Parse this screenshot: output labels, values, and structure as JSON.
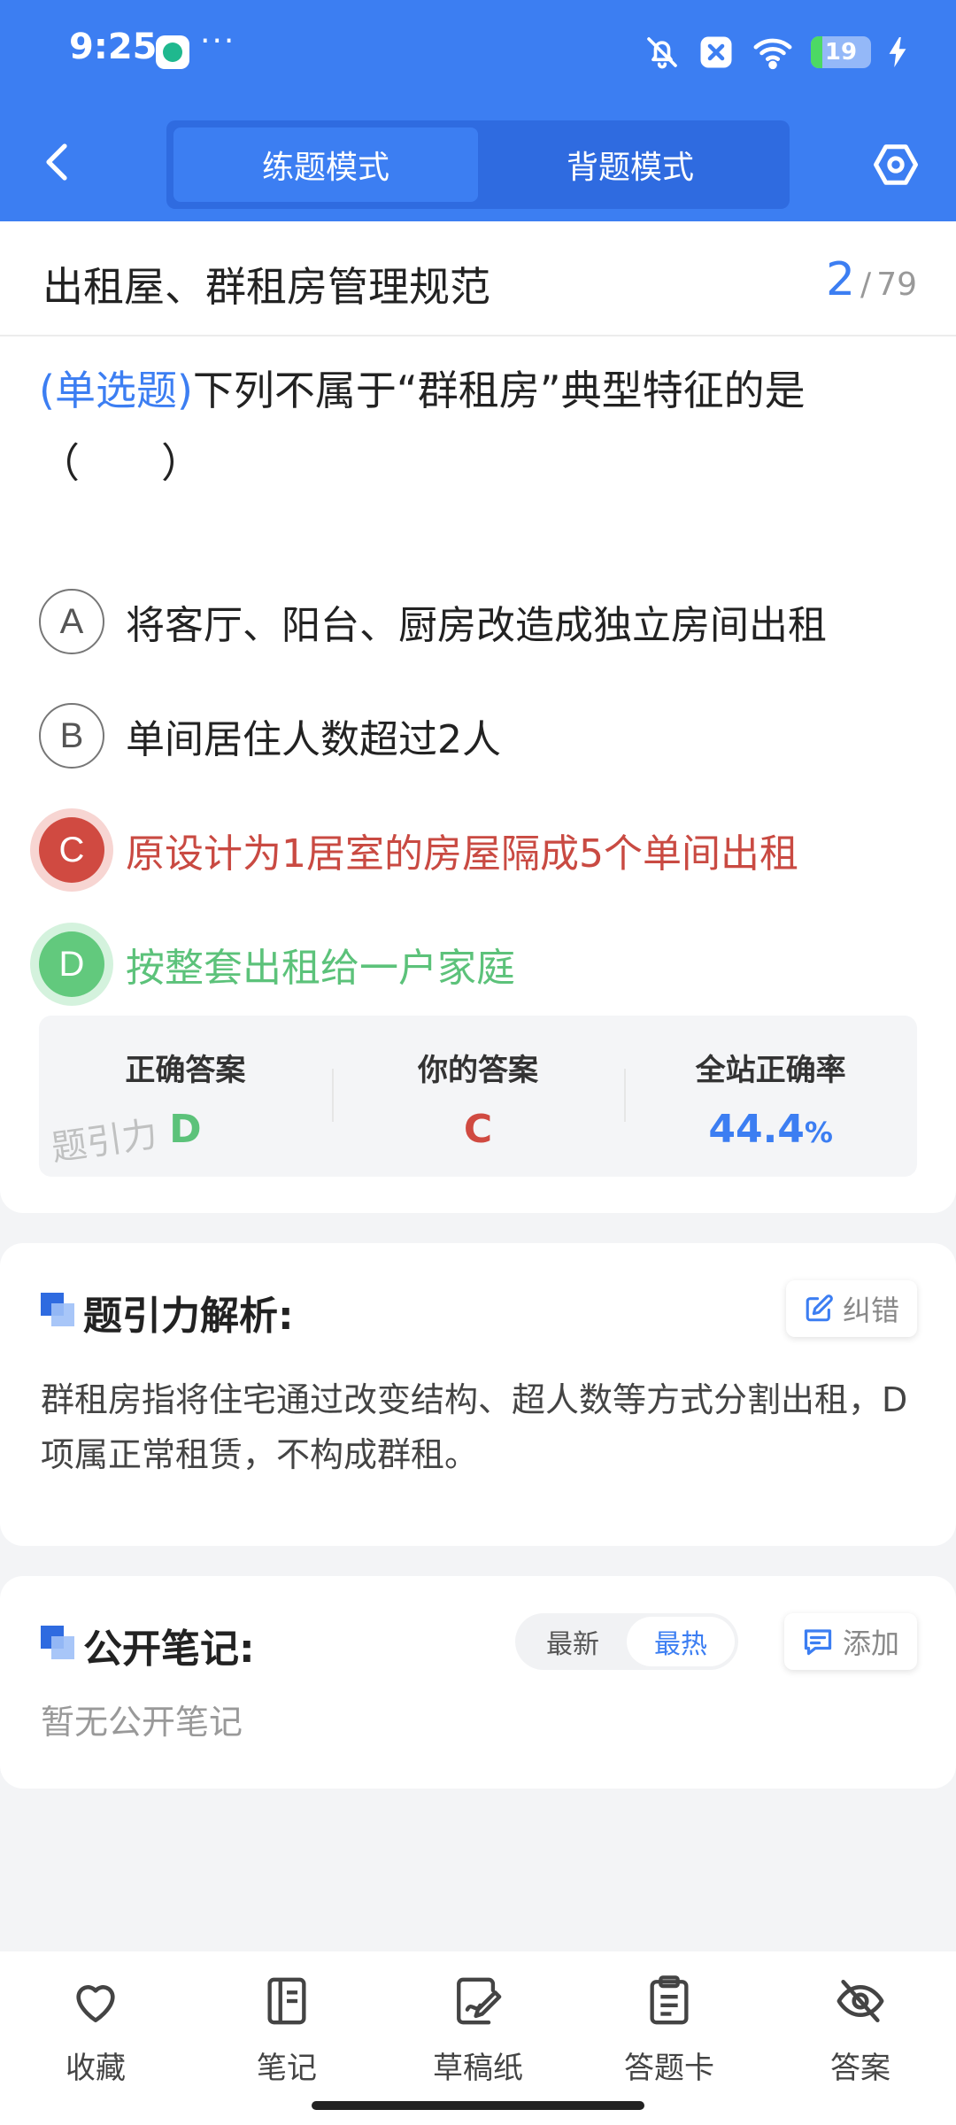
{
  "status_bar": {
    "time": "9:25",
    "more": "···",
    "battery": "19",
    "battery_fraction": 0.19
  },
  "nav": {
    "modes": [
      "练题模式",
      "背题模式"
    ],
    "active_mode": 0
  },
  "question": {
    "topic": "出租屋、群租房管理规范",
    "progress_current": "2",
    "progress_separator": "/",
    "progress_total": "79",
    "type": "(单选题)",
    "stem": "下列不属于“群租房”典型特征的是（　　）",
    "options": [
      {
        "letter": "A",
        "text": "将客厅、阳台、厨房改造成独立房间出租",
        "state": "normal"
      },
      {
        "letter": "B",
        "text": "单间居住人数超过2人",
        "state": "normal"
      },
      {
        "letter": "C",
        "text": "原设计为1居室的房屋隔成5个单间出租",
        "state": "wrong"
      },
      {
        "letter": "D",
        "text": "按整套出租给一户家庭",
        "state": "correct"
      }
    ]
  },
  "answer_panel": {
    "correct_label": "正确答案",
    "correct_value": "D",
    "yours_label": "你的答案",
    "yours_value": "C",
    "rate_label": "全站正确率",
    "rate_value": "44.4",
    "rate_unit": "%",
    "watermark": "题引力"
  },
  "analysis": {
    "title": "题引力解析:",
    "report_button": "纠错",
    "text": "群租房指将住宅通过改变结构、超人数等方式分割出租，D项属正常租赁，不构成群租。"
  },
  "notes": {
    "title": "公开笔记:",
    "sort_options": [
      "最新",
      "最热"
    ],
    "active_sort": 1,
    "add_button": "添加",
    "empty_text": "暂无公开笔记"
  },
  "bottom_bar": [
    {
      "label": "收藏",
      "icon": "heart-icon"
    },
    {
      "label": "笔记",
      "icon": "notebook-icon"
    },
    {
      "label": "草稿纸",
      "icon": "draft-paper-icon"
    },
    {
      "label": "答题卡",
      "icon": "answer-card-icon"
    },
    {
      "label": "答案",
      "icon": "eye-off-icon"
    }
  ],
  "colors": {
    "primary": "#3c7ef2",
    "wrong": "#d04a41",
    "correct": "#5cc27a"
  }
}
